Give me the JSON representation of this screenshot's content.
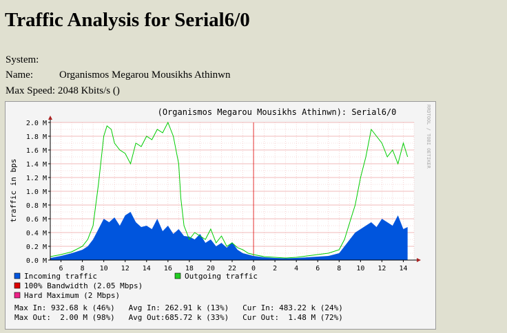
{
  "page": {
    "title": "Traffic Analysis for Serial6/0"
  },
  "info": {
    "system_label": "System:",
    "system_value": "",
    "name_label": "Name:",
    "name_value": "Organismos Megarou Mousikhs Athinwn",
    "max_speed_label": "Max Speed:",
    "max_speed_value": "2048 Kbits/s ()"
  },
  "graph": {
    "title": "(Organismos Megarou Mousikhs Athinwn): Serial6/0",
    "watermark": "RRDTOOL / TOBI OETIKER",
    "ylabel": "traffic in bps",
    "colors": {
      "incoming": "#0055dd",
      "outgoing": "#00cc00",
      "bandwidth": "#dd0000",
      "hardmax": "#ee2288",
      "canvas": "#ffffff",
      "frame": "#f4f4f4",
      "grid": "#f0b8b8"
    },
    "legend": [
      {
        "label": "Incoming traffic",
        "color": "#0055dd"
      },
      {
        "label": "Outgoing traffic",
        "color": "#22cc22"
      },
      {
        "label": "100% Bandwidth (2.05 Mbps)",
        "color": "#dd0000"
      },
      {
        "label": "Hard Maximum (2 Mbps)",
        "color": "#ee2288"
      }
    ],
    "stats": [
      "Max In: 932.68 k (46%)   Avg In: 262.91 k (13%)   Cur In: 483.22 k (24%)",
      "Max Out:  2.00 M (98%)   Avg Out:685.72 k (33%)   Cur Out:  1.48 M (72%)"
    ]
  },
  "chart_data": {
    "type": "area",
    "title": "(Organismos Megarou Mousikhs Athinwn): Serial6/0",
    "xlabel": "",
    "ylabel": "traffic in bps",
    "ylim": [
      0,
      2000000
    ],
    "y_ticks": [
      "0.0 M",
      "0.2 M",
      "0.4 M",
      "0.6 M",
      "0.8 M",
      "1.0 M",
      "1.2 M",
      "1.4 M",
      "1.6 M",
      "1.8 M",
      "2.0 M"
    ],
    "x_ticks": [
      "6",
      "8",
      "10",
      "12",
      "14",
      "16",
      "18",
      "20",
      "22",
      "0",
      "2",
      "4",
      "6",
      "8",
      "10",
      "12",
      "14"
    ],
    "x_hours": [
      6,
      8,
      10,
      12,
      14,
      16,
      18,
      20,
      22,
      24,
      26,
      28,
      30,
      32,
      34,
      36,
      38
    ],
    "xlim": [
      5,
      39
    ],
    "grid": true,
    "series": [
      {
        "name": "Incoming traffic",
        "x": [
          5,
          6,
          7,
          8,
          8.5,
          9,
          9.5,
          10,
          10.5,
          11,
          11.5,
          12,
          12.5,
          13,
          13.5,
          14,
          14.5,
          15,
          15.5,
          16,
          16.5,
          17,
          17.5,
          18,
          18.5,
          19,
          19.5,
          20,
          20.5,
          21,
          21.5,
          22,
          22.5,
          23,
          23.5,
          24,
          25,
          26,
          27,
          28,
          29,
          30,
          31,
          32,
          32.5,
          33,
          33.5,
          34,
          34.5,
          35,
          35.5,
          36,
          36.5,
          37,
          37.5,
          38,
          38.4
        ],
        "y": [
          30000,
          60000,
          100000,
          150000,
          200000,
          300000,
          450000,
          600000,
          550000,
          620000,
          500000,
          650000,
          700000,
          550000,
          480000,
          500000,
          450000,
          600000,
          420000,
          500000,
          380000,
          450000,
          350000,
          340000,
          300000,
          380000,
          250000,
          300000,
          200000,
          250000,
          180000,
          260000,
          150000,
          100000,
          80000,
          60000,
          40000,
          30000,
          25000,
          30000,
          40000,
          50000,
          60000,
          100000,
          200000,
          300000,
          400000,
          450000,
          500000,
          550000,
          480000,
          600000,
          550000,
          500000,
          650000,
          450000,
          480000
        ]
      },
      {
        "name": "Outgoing traffic",
        "x": [
          5,
          6,
          7,
          8,
          8.5,
          9,
          9.5,
          10,
          10.3,
          10.7,
          11,
          11.5,
          12,
          12.5,
          13,
          13.5,
          14,
          14.5,
          15,
          15.5,
          16,
          16.5,
          17,
          17.2,
          17.5,
          18,
          18.5,
          19,
          19.5,
          20,
          20.5,
          21,
          21.5,
          22,
          22.5,
          23,
          23.5,
          24,
          25,
          26,
          27,
          28,
          29,
          30,
          31,
          32,
          32.5,
          33,
          33.5,
          34,
          34.5,
          35,
          35.5,
          36,
          36.5,
          37,
          37.5,
          38,
          38.4
        ],
        "y": [
          50000,
          80000,
          120000,
          200000,
          300000,
          500000,
          1100000,
          1800000,
          1950000,
          1900000,
          1700000,
          1600000,
          1550000,
          1400000,
          1700000,
          1650000,
          1800000,
          1750000,
          1900000,
          1850000,
          2000000,
          1800000,
          1400000,
          900000,
          500000,
          300000,
          400000,
          350000,
          300000,
          450000,
          250000,
          350000,
          200000,
          250000,
          180000,
          150000,
          100000,
          80000,
          50000,
          40000,
          30000,
          40000,
          60000,
          80000,
          100000,
          150000,
          300000,
          550000,
          800000,
          1200000,
          1500000,
          1900000,
          1800000,
          1700000,
          1500000,
          1600000,
          1400000,
          1700000,
          1500000
        ]
      }
    ]
  }
}
